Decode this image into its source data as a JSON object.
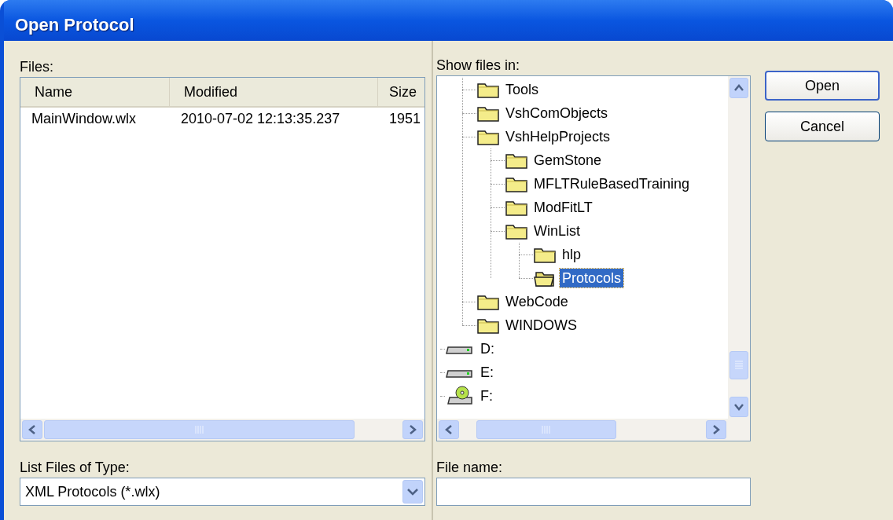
{
  "window": {
    "title": "Open Protocol"
  },
  "files": {
    "label": "Files:",
    "columns": [
      "Name",
      "Modified",
      "Size"
    ],
    "rows": [
      [
        "MainWindow.wlx",
        "2010-07-02 12:13:35.237",
        "1951"
      ]
    ]
  },
  "file_type": {
    "label": "List Files of Type:",
    "value": "XML Protocols (*.wlx)"
  },
  "folders": {
    "label": "Show files in:",
    "items": [
      {
        "label": "Tools",
        "kind": "folder",
        "selected": false
      },
      {
        "label": "VshComObjects",
        "kind": "folder",
        "selected": false
      },
      {
        "label": "VshHelpProjects",
        "kind": "folder",
        "selected": false,
        "children": [
          {
            "label": "GemStone",
            "kind": "folder",
            "selected": false
          },
          {
            "label": "MFLTRuleBasedTraining",
            "kind": "folder",
            "selected": false
          },
          {
            "label": "ModFitLT",
            "kind": "folder",
            "selected": false
          },
          {
            "label": "WinList",
            "kind": "folder",
            "selected": false,
            "children": [
              {
                "label": "hlp",
                "kind": "folder",
                "selected": false
              },
              {
                "label": "Protocols",
                "kind": "open-folder",
                "selected": true
              }
            ]
          }
        ]
      },
      {
        "label": "WebCode",
        "kind": "folder",
        "selected": false
      },
      {
        "label": "WINDOWS",
        "kind": "folder",
        "selected": false
      }
    ],
    "drives": [
      {
        "label": "D:",
        "kind": "drive",
        "selected": false
      },
      {
        "label": "E:",
        "kind": "drive",
        "selected": false
      },
      {
        "label": "F:",
        "kind": "cd-drive",
        "selected": false
      }
    ]
  },
  "file_name": {
    "label": "File name:"
  },
  "buttons": [
    "Open",
    "Cancel"
  ]
}
